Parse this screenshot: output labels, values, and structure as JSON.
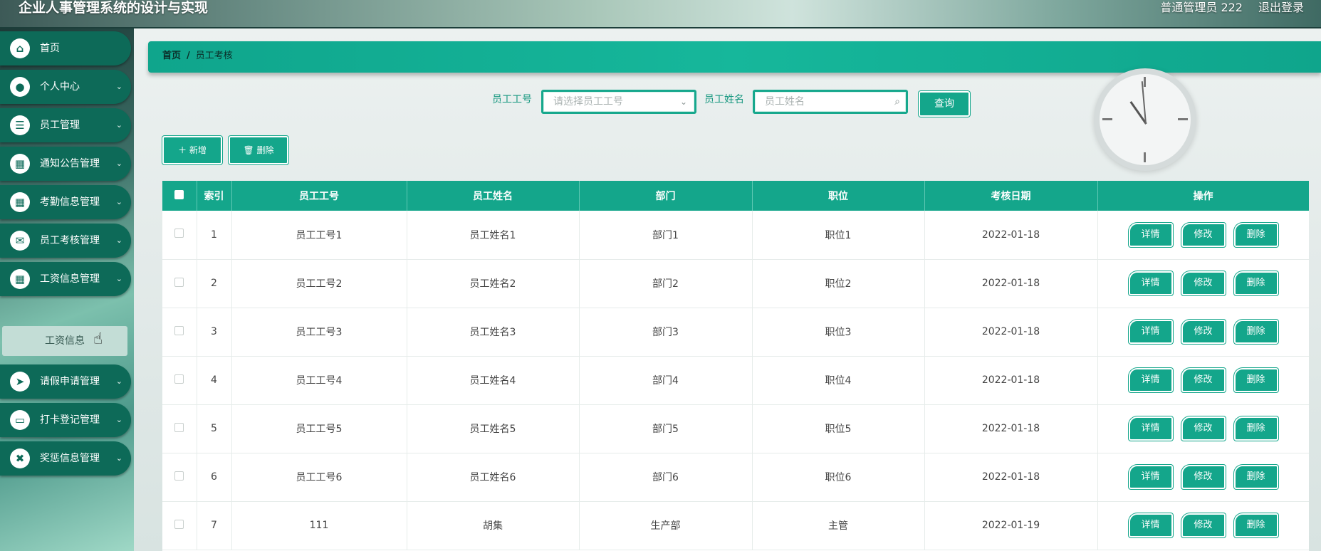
{
  "app": {
    "title": "企业人事管理系统的设计与实现"
  },
  "header": {
    "user": "普通管理员 222",
    "logout": "退出登录"
  },
  "sidebar": {
    "items": [
      {
        "label": "首页",
        "icon": "home-icon",
        "glyph": "⌂",
        "chev": ""
      },
      {
        "label": "个人中心",
        "icon": "user-icon",
        "glyph": "●",
        "chev": "⌄"
      },
      {
        "label": "员工管理",
        "icon": "list-icon",
        "glyph": "☰",
        "chev": "⌄"
      },
      {
        "label": "通知公告管理",
        "icon": "grid-icon",
        "glyph": "▦",
        "chev": "⌄"
      },
      {
        "label": "考勤信息管理",
        "icon": "grid-icon",
        "glyph": "▦",
        "chev": "⌄"
      },
      {
        "label": "员工考核管理",
        "icon": "chat-icon",
        "glyph": "✉",
        "chev": "⌄"
      },
      {
        "label": "工资信息管理",
        "icon": "grid-icon",
        "glyph": "▦",
        "chev": "⌄"
      },
      {
        "label": "请假申请管理",
        "icon": "send-icon",
        "glyph": "➤",
        "chev": "⌄"
      },
      {
        "label": "打卡登记管理",
        "icon": "monitor-icon",
        "glyph": "▭",
        "chev": "⌄"
      },
      {
        "label": "奖惩信息管理",
        "icon": "clipboard-icon",
        "glyph": "✖",
        "chev": "⌄"
      }
    ],
    "submenu": {
      "label": "工资信息"
    }
  },
  "breadcrumb": {
    "home": "首页",
    "sep": "/",
    "current": "员工考核"
  },
  "search": {
    "employee_id_label": "员工工号",
    "employee_id_placeholder": "请选择员工工号",
    "employee_name_label": "员工姓名",
    "employee_name_placeholder": "员工姓名",
    "query_label": "查询"
  },
  "actions": {
    "add_label": "＋ 新增",
    "delete_label": "🗑 删除"
  },
  "table": {
    "columns": [
      "",
      "索引",
      "员工工号",
      "员工姓名",
      "部门",
      "职位",
      "考核日期",
      "操作"
    ],
    "ops": {
      "detail": "详情",
      "edit": "修改",
      "delete": "删除"
    },
    "rows": [
      {
        "index": "1",
        "emp_id": "员工工号1",
        "emp_name": "员工姓名1",
        "dept": "部门1",
        "position": "职位1",
        "date": "2022-01-18"
      },
      {
        "index": "2",
        "emp_id": "员工工号2",
        "emp_name": "员工姓名2",
        "dept": "部门2",
        "position": "职位2",
        "date": "2022-01-18"
      },
      {
        "index": "3",
        "emp_id": "员工工号3",
        "emp_name": "员工姓名3",
        "dept": "部门3",
        "position": "职位3",
        "date": "2022-01-18"
      },
      {
        "index": "4",
        "emp_id": "员工工号4",
        "emp_name": "员工姓名4",
        "dept": "部门4",
        "position": "职位4",
        "date": "2022-01-18"
      },
      {
        "index": "5",
        "emp_id": "员工工号5",
        "emp_name": "员工姓名5",
        "dept": "部门5",
        "position": "职位5",
        "date": "2022-01-18"
      },
      {
        "index": "6",
        "emp_id": "员工工号6",
        "emp_name": "员工姓名6",
        "dept": "部门6",
        "position": "职位6",
        "date": "2022-01-18"
      },
      {
        "index": "7",
        "emp_id": "111",
        "emp_name": "胡集",
        "dept": "生产部",
        "position": "主管",
        "date": "2022-01-19"
      }
    ]
  },
  "colors": {
    "accent": "#14a68b",
    "sidebar_item": "#0d6a58"
  }
}
